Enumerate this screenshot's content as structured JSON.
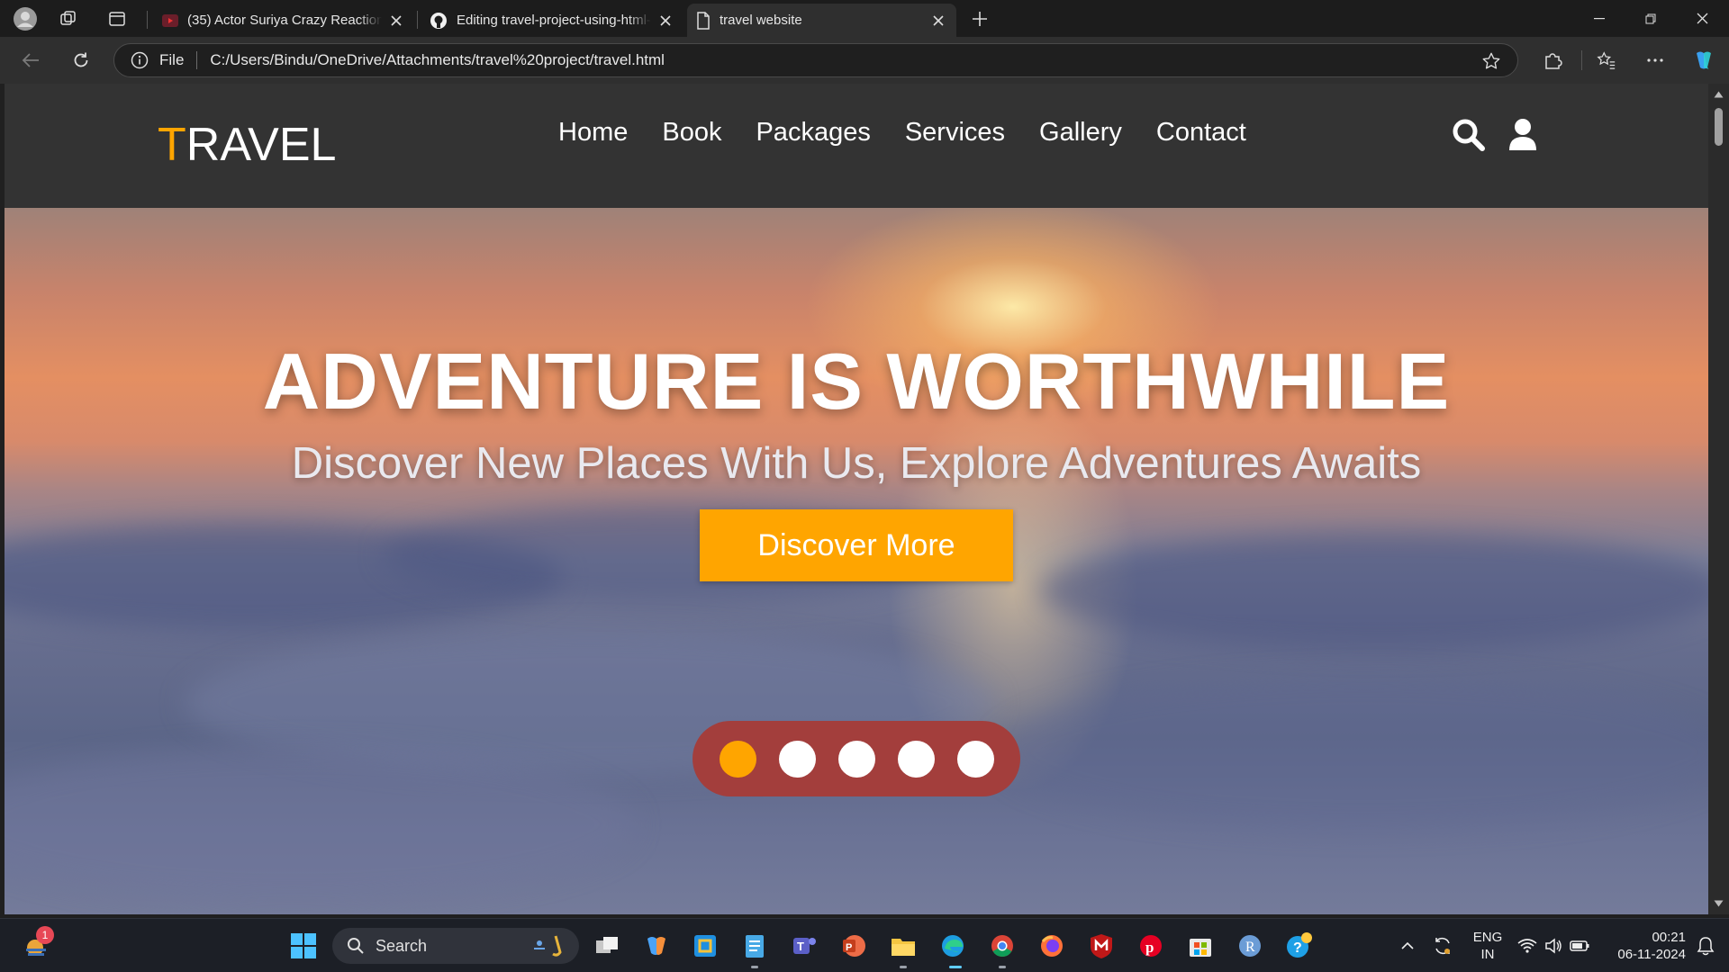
{
  "browser": {
    "tabs": [
      {
        "title": "(35) Actor Suriya Crazy Reaction f",
        "icon": "youtube-icon",
        "active": false
      },
      {
        "title": "Editing travel-project-using-html-",
        "icon": "github-icon",
        "active": false
      },
      {
        "title": "travel website",
        "icon": "page-icon",
        "active": true
      }
    ],
    "address": {
      "scheme_label": "File",
      "url": "C:/Users/Bindu/OneDrive/Attachments/travel%20project/travel.html"
    }
  },
  "site": {
    "logo": {
      "accent": "T",
      "rest": "RAVEL"
    },
    "nav": [
      "Home",
      "Book",
      "Packages",
      "Services",
      "Gallery",
      "Contact"
    ],
    "header_icons": [
      "search-icon",
      "user-icon"
    ],
    "hero": {
      "title": "ADVENTURE IS WORTHWHILE",
      "subtitle": "Discover New Places With Us, Explore Adventures Awaits",
      "button": "Discover More"
    },
    "slider": {
      "count": 5,
      "active_index": 0
    },
    "colors": {
      "accent": "#ffa500",
      "header_bg": "#333333",
      "slider_bg": "#a33e3c"
    }
  },
  "taskbar": {
    "search_placeholder": "Search",
    "weather_badge": "1",
    "tray": {
      "lang_top": "ENG",
      "lang_bottom": "IN",
      "time": "00:21",
      "date": "06-11-2024"
    }
  }
}
